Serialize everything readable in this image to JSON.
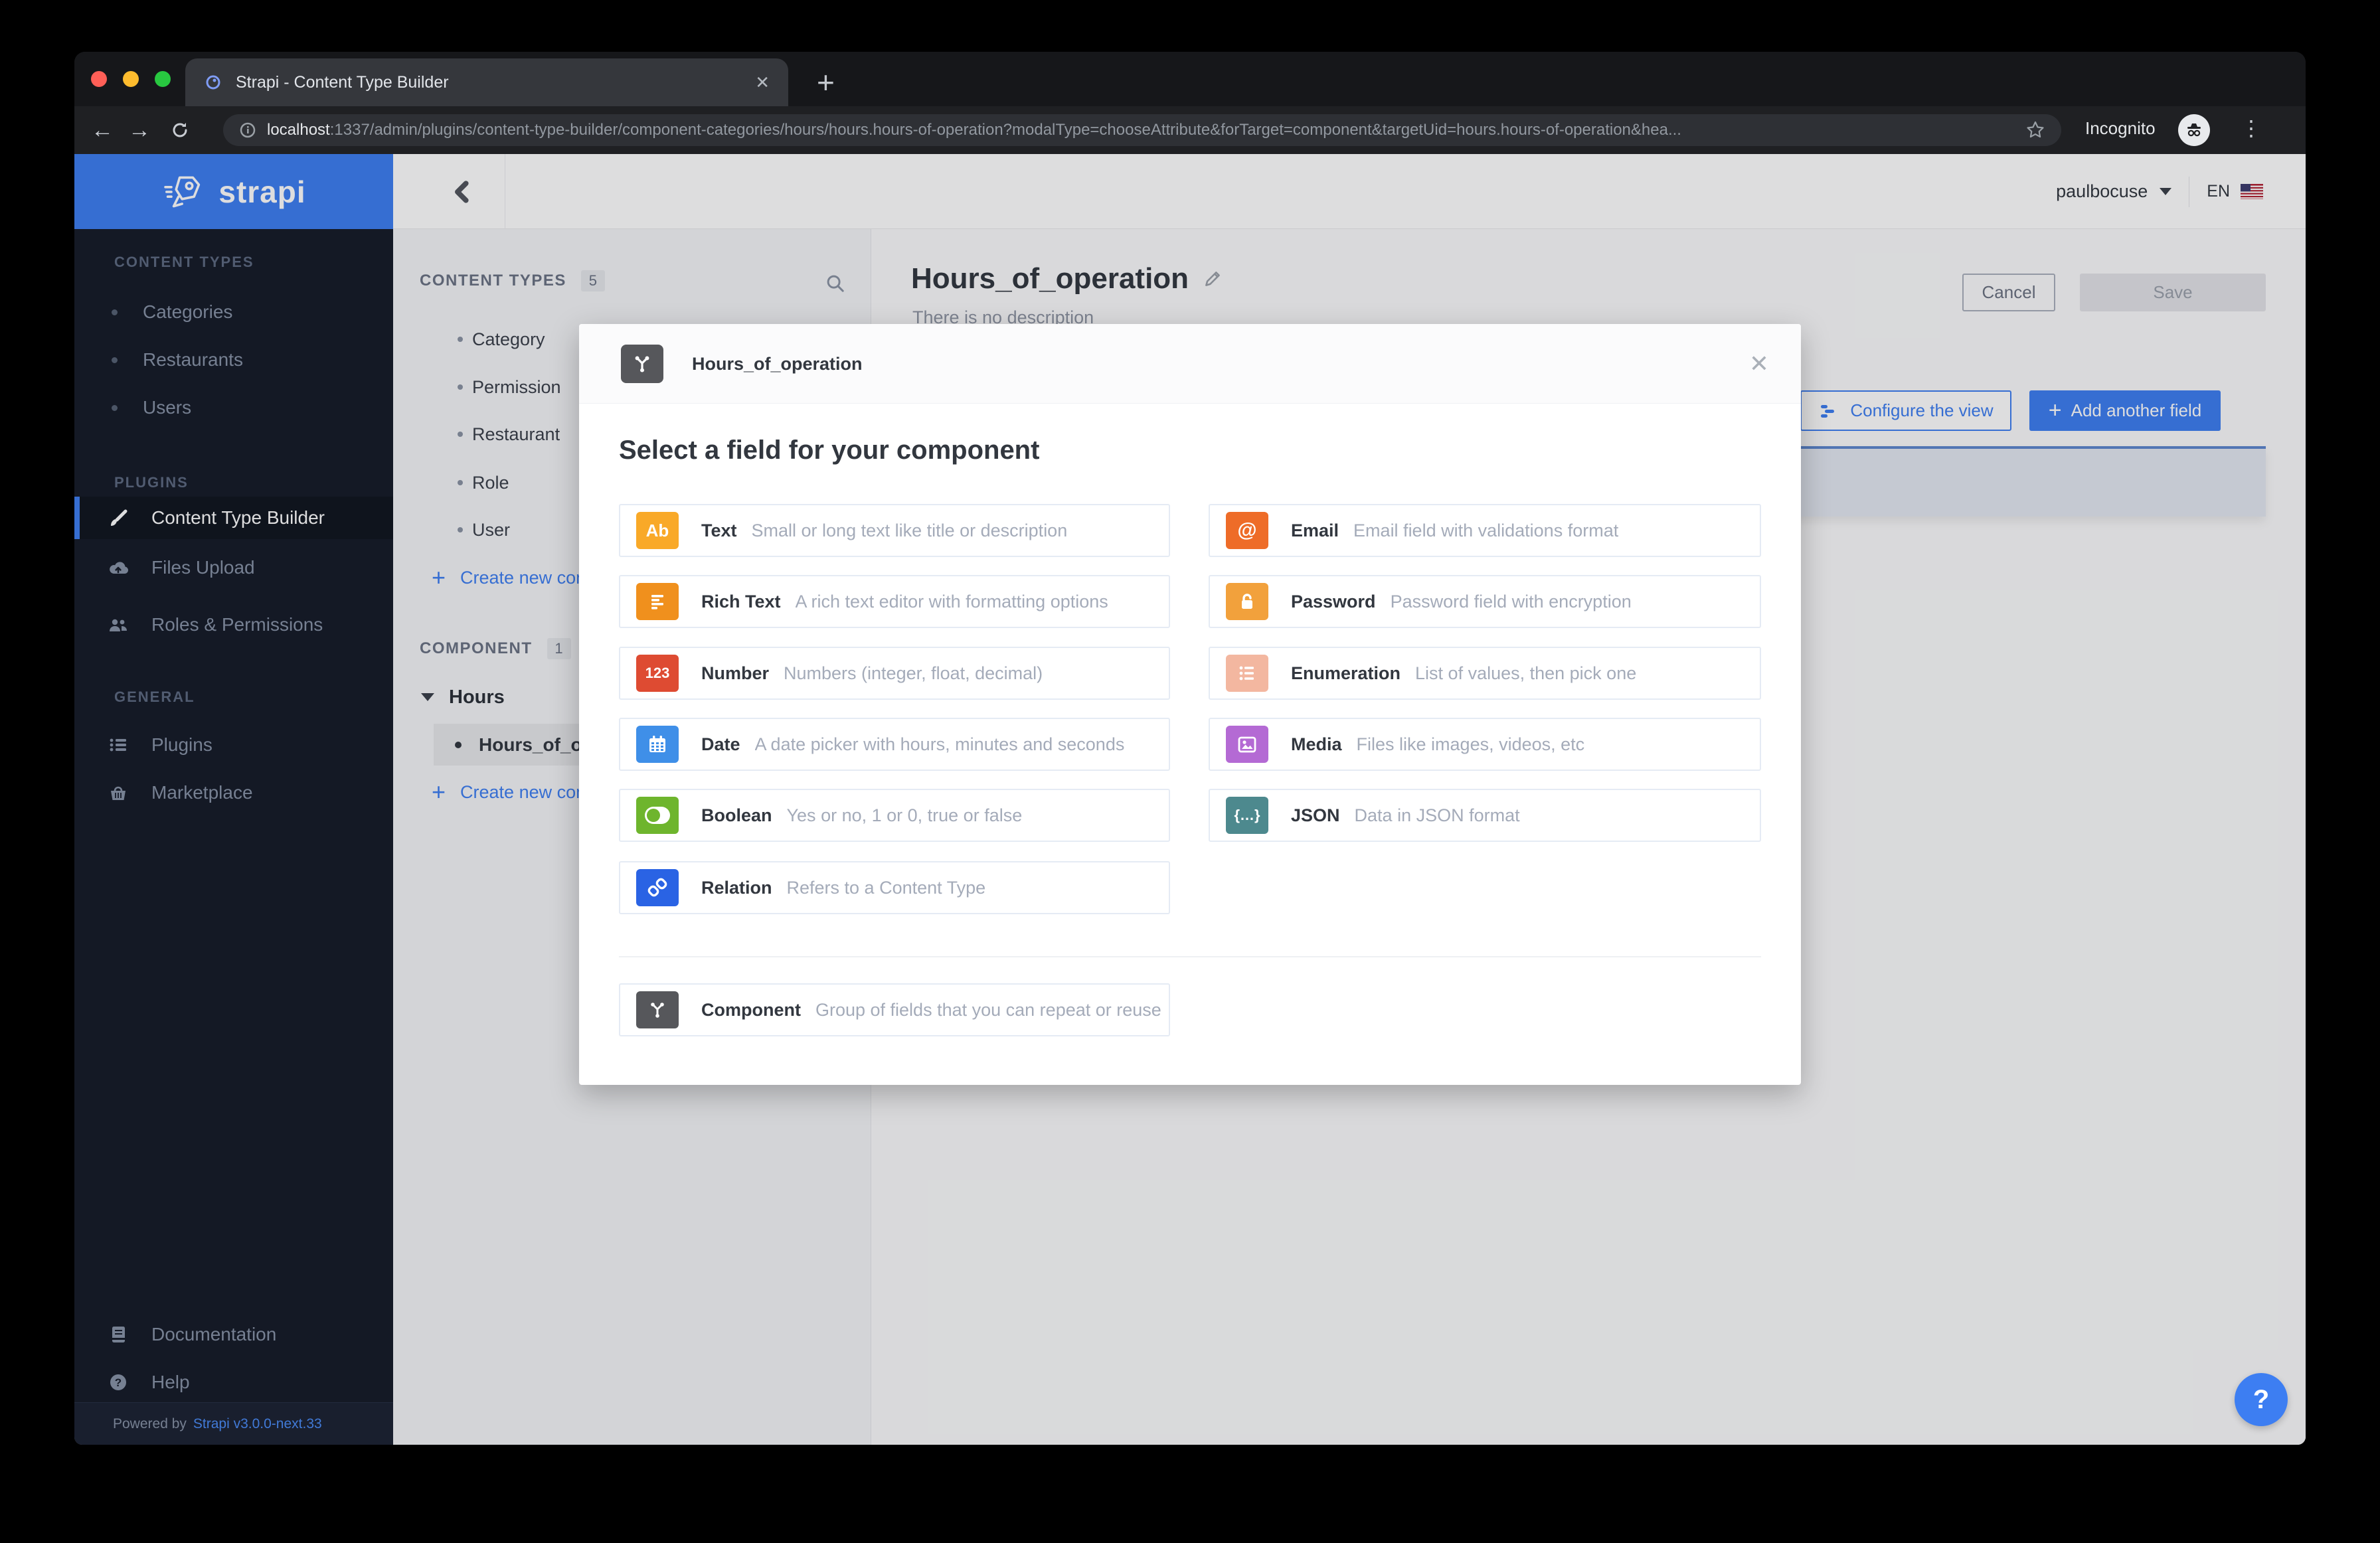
{
  "colors": {
    "accent": "#3d7ef2",
    "sidebar_bg": "#151b28",
    "sidebar_footer_bg": "#1b2233"
  },
  "browser": {
    "tab_title": "Strapi - Content Type Builder",
    "url_host": "localhost",
    "url_rest": ":1337/admin/plugins/content-type-builder/component-categories/hours/hours.hours-of-operation?modalType=chooseAttribute&forTarget=component&targetUid=hours.hours-of-operation&hea...",
    "incognito_label": "Incognito"
  },
  "sidebar": {
    "logo_text": "strapi",
    "content_types_title": "CONTENT TYPES",
    "content_types": [
      "Categories",
      "Restaurants",
      "Users"
    ],
    "plugins_title": "PLUGINS",
    "plugins": [
      "Content Type Builder",
      "Files Upload",
      "Roles & Permissions"
    ],
    "general_title": "GENERAL",
    "general": [
      "Plugins",
      "Marketplace"
    ],
    "footer_links": [
      "Documentation",
      "Help"
    ],
    "powered_by": "Powered by",
    "version_link": "Strapi v3.0.0-next.33"
  },
  "header": {
    "user": "paulbocuse",
    "locale": "EN"
  },
  "panel": {
    "content_types_title": "CONTENT TYPES",
    "content_types_count": "5",
    "items": [
      "Category",
      "Permission",
      "Restaurant",
      "Role",
      "User"
    ],
    "create_content_type": "Create new con",
    "component_title": "COMPONENT",
    "component_count": "1",
    "group_label": "Hours",
    "component_item": "Hours_of_ope",
    "create_component": "Create new com"
  },
  "page": {
    "title": "Hours_of_operation",
    "subtitle": "There is no description",
    "cancel_label": "Cancel",
    "save_label": "Save",
    "configure_view_label": "Configure the view",
    "add_field_label": "Add another field"
  },
  "modal": {
    "title": "Hours_of_operation",
    "heading": "Select a field for your component",
    "fields_left": [
      {
        "label": "Text",
        "desc": "Small or long text like title or description",
        "color": "#f9a928",
        "glyph": "Ab"
      },
      {
        "label": "Rich Text",
        "desc": "A rich text editor with formatting options",
        "color": "#f0901d"
      },
      {
        "label": "Number",
        "desc": "Numbers (integer, float, decimal)",
        "color": "#de4b32",
        "glyph": "123"
      },
      {
        "label": "Date",
        "desc": "A date picker with hours, minutes and seconds",
        "color": "#3f8fe8"
      },
      {
        "label": "Boolean",
        "desc": "Yes or no, 1 or 0, true or false",
        "color": "#6eb52d"
      },
      {
        "label": "Relation",
        "desc": "Refers to a Content Type",
        "color": "#2a63e4"
      }
    ],
    "fields_right": [
      {
        "label": "Email",
        "desc": "Email field with validations format",
        "color": "#ee6c28",
        "glyph": "@"
      },
      {
        "label": "Password",
        "desc": "Password field with encryption",
        "color": "#f2a13c"
      },
      {
        "label": "Enumeration",
        "desc": "List of values, then pick one",
        "color": "#f3b7a0"
      },
      {
        "label": "Media",
        "desc": "Files like images, videos, etc",
        "color": "#b46ad4"
      },
      {
        "label": "JSON",
        "desc": "Data in JSON format",
        "color": "#4d898e",
        "glyph": "{…}"
      }
    ],
    "field_component": {
      "label": "Component",
      "desc": "Group of fields that you can repeat or reuse",
      "color": "#56575b"
    }
  }
}
